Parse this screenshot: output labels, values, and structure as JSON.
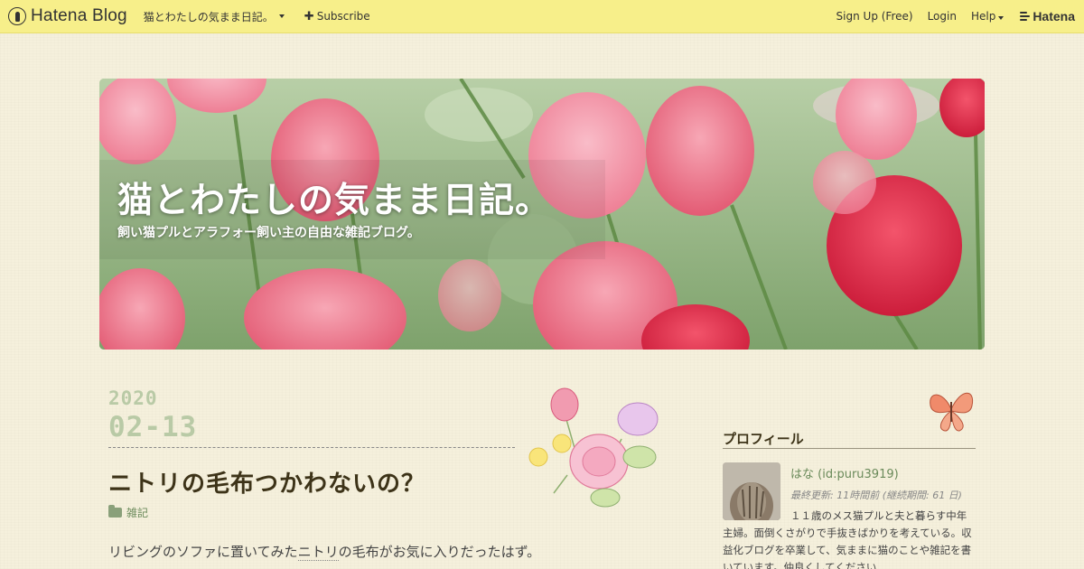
{
  "topbar": {
    "brand": "Hatena Blog",
    "blog_name": "猫とわたしの気まま日記。",
    "subscribe": "Subscribe",
    "signup": "Sign Up (Free)",
    "login": "Login",
    "help": "Help",
    "hatena": "Hatena"
  },
  "header": {
    "title": "猫とわたしの気まま日記。",
    "description": "飼い猫プルとアラフォー飼い主の自由な雑記ブログ。"
  },
  "entry": {
    "year": "2020",
    "month_day": "02-13",
    "title": "ニトリの毛布つかわないの？",
    "category": "雑記",
    "text_before": "リビングのソファに置いてみた",
    "text_keyword": "ニトリ",
    "text_after": "の毛布がお気に入りだったはず。"
  },
  "sidebar": {
    "profile_heading": "プロフィール",
    "name": "はな (id:puru3919)",
    "updated": "最終更新: 11時間前 (継続期間: 61 日)",
    "bio": "１１歳のメス猫プルと夫と暮らす中年主婦。面倒くさがりで手抜きばかりを考えている。収益化ブログを卒業して、気ままに猫のことや雑記を書いています。仲良くしてください"
  },
  "colors": {
    "topbar_bg": "#f7ef8a",
    "page_bg": "#f5f0dc",
    "date_color": "#b9caa6",
    "category_color": "#6a8a5a"
  }
}
